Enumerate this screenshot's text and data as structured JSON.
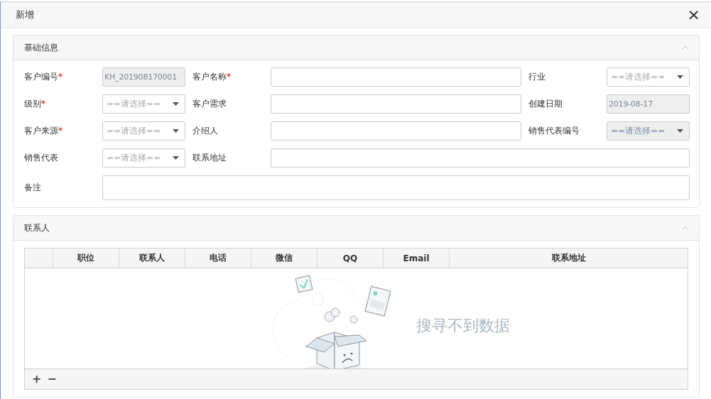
{
  "window": {
    "title": "新增",
    "close": "×"
  },
  "basic_panel": {
    "title": "基础信息",
    "expanded": true,
    "rows": [
      [
        {
          "label": "客户编号",
          "mark": "*",
          "kind": "text",
          "value": "KH_201908170001",
          "disabled": true
        },
        {
          "label": "客户名称",
          "mark": "*",
          "kind": "text",
          "disabled": false
        },
        {
          "label": "行业",
          "kind": "select",
          "placeholder": "==请选择==",
          "disabled": false
        }
      ],
      [
        {
          "label": "级别",
          "mark": "*",
          "kind": "select",
          "placeholder": "==请选择==",
          "disabled": false
        },
        {
          "label": "客户需求",
          "kind": "text",
          "disabled": false
        },
        {
          "label": "创建日期",
          "kind": "text",
          "value": "2019-08-17",
          "disabled": true
        }
      ],
      [
        {
          "label": "客户来源",
          "mark": "*",
          "kind": "select",
          "placeholder": "==请选择==",
          "disabled": false
        },
        {
          "label": "介绍人",
          "kind": "text",
          "disabled": false
        },
        {
          "label": "销售代表编号",
          "kind": "select",
          "placeholder": "==请选择==",
          "disabled": true
        }
      ],
      [
        {
          "label": "销售代表",
          "kind": "select",
          "placeholder": "==请选择==",
          "disabled": false
        },
        {
          "label": "联系地址",
          "kind": "text",
          "disabled": false
        }
      ],
      [
        {
          "label": "备注",
          "kind": "textarea",
          "disabled": false
        }
      ]
    ]
  },
  "contacts_panel": {
    "title": "联系人",
    "expanded": true,
    "table": {
      "columns": [
        "职位",
        "联系人",
        "电话",
        "微信",
        "QQ",
        "Email",
        "联系地址"
      ],
      "empty_text": "搜寻不到数据"
    },
    "toolbar": [
      "+",
      "−"
    ]
  }
}
